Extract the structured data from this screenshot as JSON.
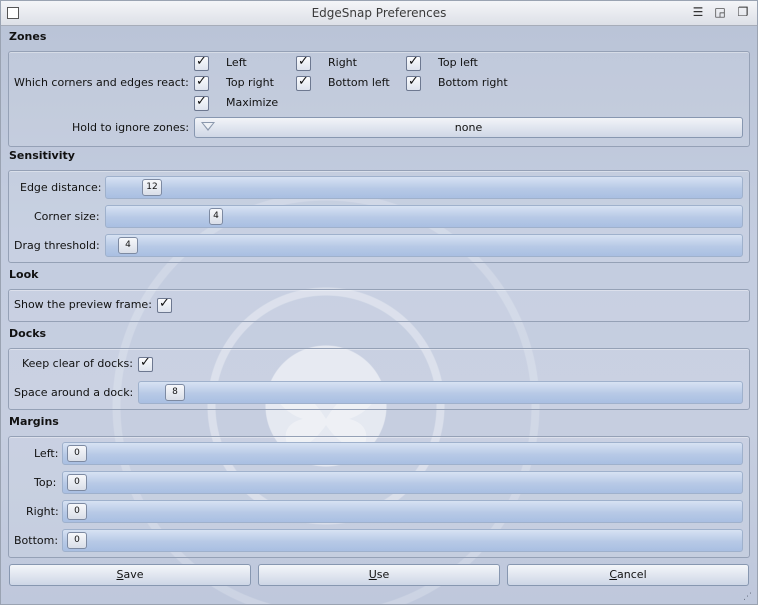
{
  "window": {
    "title": "EdgeSnap Preferences"
  },
  "zones": {
    "heading": "Zones",
    "corners_label": "Which corners and edges react:",
    "checkboxes": [
      "Left",
      "Right",
      "Top left",
      "Top right",
      "Bottom left",
      "Bottom right",
      "Maximize"
    ],
    "hold_label": "Hold to ignore zones:",
    "hold_value": "none"
  },
  "sensitivity": {
    "heading": "Sensitivity",
    "edge_label": "Edge distance:",
    "edge_value": "12",
    "corner_label": "Corner size:",
    "corner_value": "4",
    "drag_label": "Drag threshold:",
    "drag_value": "4"
  },
  "look": {
    "heading": "Look",
    "preview_label": "Show the preview frame:"
  },
  "docks": {
    "heading": "Docks",
    "clear_label": "Keep clear of docks:",
    "space_label": "Space around a dock:",
    "space_value": "8"
  },
  "margins": {
    "heading": "Margins",
    "left_label": "Left:",
    "left_value": "0",
    "top_label": "Top:",
    "top_value": "0",
    "right_label": "Right:",
    "right_value": "0",
    "bottom_label": "Bottom:",
    "bottom_value": "0"
  },
  "buttons": {
    "save_u": "S",
    "save_rest": "ave",
    "use_u": "U",
    "use_rest": "se",
    "cancel_u": "C",
    "cancel_rest": "ancel"
  },
  "icons": {
    "window": "window-menu-icon",
    "menu": "hamburger-menu-icon",
    "maximize": "maximize-icon",
    "restore": "restore-icon"
  }
}
